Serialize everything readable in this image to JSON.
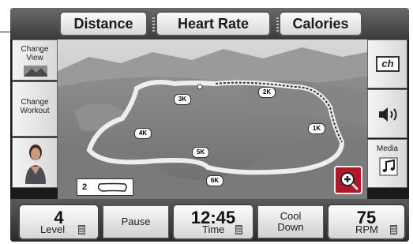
{
  "top_tabs": [
    {
      "label": "Distance"
    },
    {
      "label": "Heart Rate"
    },
    {
      "label": "Calories"
    }
  ],
  "left_panel": {
    "change_view": "Change\nView",
    "change_workout": "Change\nWorkout"
  },
  "right_panel": {
    "channel_icon_text": "ch",
    "media_label": "Media"
  },
  "map": {
    "route_markers": [
      "1K",
      "2K",
      "3K",
      "4K",
      "5K",
      "6K"
    ],
    "lap_count": "2",
    "zoom_icon": "zoom-in-icon"
  },
  "bottom": {
    "level": {
      "value": "4",
      "label": "Level"
    },
    "pause_label": "Pause",
    "time": {
      "value": "12:45",
      "label": "Time"
    },
    "cool_down_label": "Cool\nDown",
    "rpm": {
      "value": "75",
      "label": "RPM"
    }
  },
  "colors": {
    "frame": "#1a1a1a",
    "route": "#e8e8e8",
    "accent_zoom": "#b0182a"
  }
}
